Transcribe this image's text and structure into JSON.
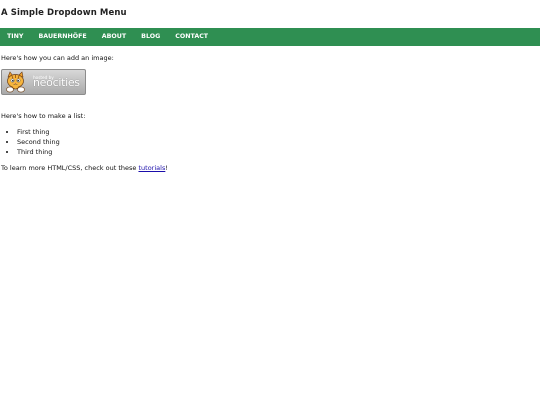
{
  "header": {
    "title": "A Simple Dropdown Menu"
  },
  "nav": {
    "items": [
      {
        "label": "TINY"
      },
      {
        "label": "BAUERNHÖFE"
      },
      {
        "label": "ABOUT"
      },
      {
        "label": "BLOG"
      },
      {
        "label": "CONTACT"
      }
    ],
    "background_color": "#2f8f52"
  },
  "main": {
    "image_intro": "Here's how you can add an image:",
    "badge": {
      "hosted_text": "hosted by",
      "brand_text": "neocities"
    },
    "list_intro": "Here's how to make a list:",
    "list_items": [
      "First thing",
      "Second thing",
      "Third thing"
    ],
    "tutorial_prefix": "To learn more HTML/CSS, check out these ",
    "tutorial_link": "tutorials",
    "tutorial_suffix": "!"
  }
}
